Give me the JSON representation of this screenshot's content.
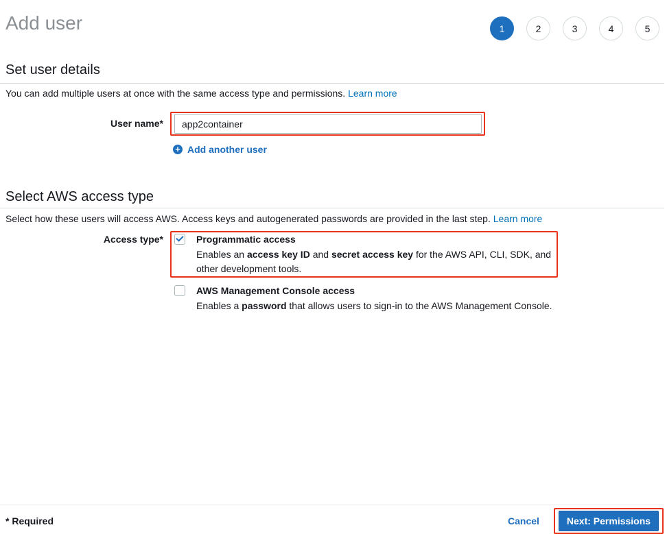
{
  "header": {
    "title": "Add user",
    "steps": [
      "1",
      "2",
      "3",
      "4",
      "5"
    ],
    "active_step": "1"
  },
  "user_details": {
    "title": "Set user details",
    "description": "You can add multiple users at once with the same access type and permissions.",
    "learn_more": "Learn more",
    "user_name_label": "User name*",
    "user_name_value": "app2container",
    "add_another_user": "Add another user"
  },
  "access_type": {
    "title": "Select AWS access type",
    "description": "Select how these users will access AWS. Access keys and autogenerated passwords are provided in the last step.",
    "learn_more": "Learn more",
    "label": "Access type*",
    "options": [
      {
        "title": "Programmatic access",
        "checked": true,
        "desc_parts": [
          "Enables an ",
          "access key ID",
          " and ",
          "secret access key",
          " for the AWS API, CLI, SDK, and other development tools."
        ]
      },
      {
        "title": "AWS Management Console access",
        "checked": false,
        "desc_parts": [
          "Enables a ",
          "password",
          " that allows users to sign-in to the AWS Management Console."
        ]
      }
    ]
  },
  "footer": {
    "required_note": "* Required",
    "cancel": "Cancel",
    "next": "Next: Permissions"
  },
  "colors": {
    "accent": "#1f6fbf",
    "highlight": "#e8321c",
    "link": "#0073bb"
  }
}
